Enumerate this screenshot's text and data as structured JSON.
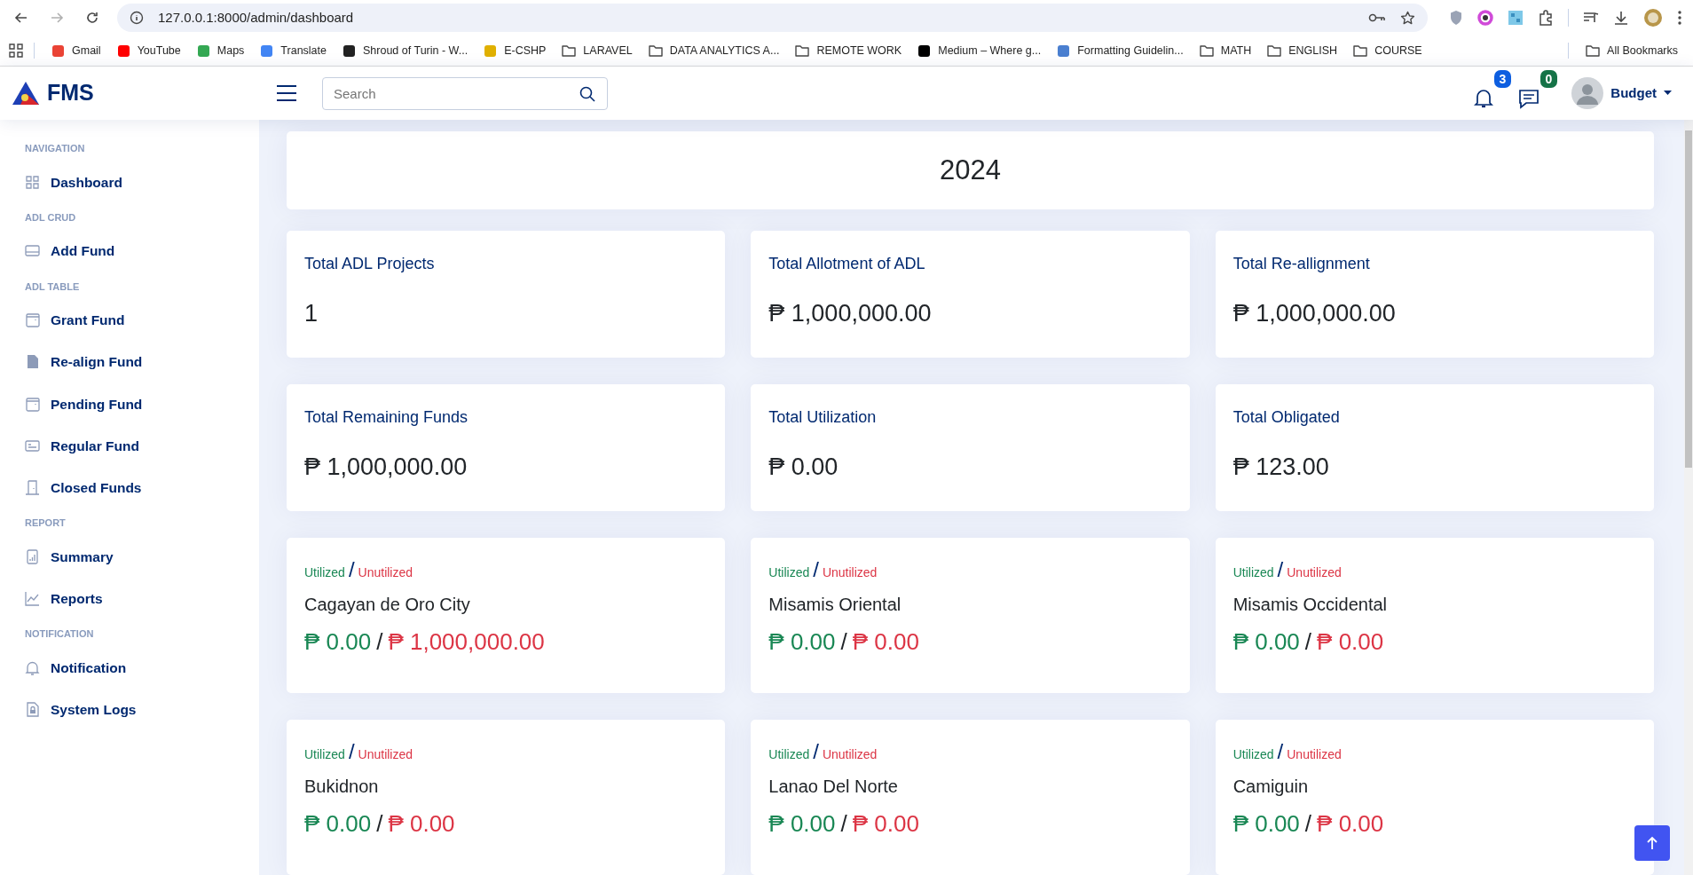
{
  "browser": {
    "back_enabled": true,
    "forward_enabled": false,
    "url": "127.0.0.1:8000/admin/dashboard",
    "bookmarks": [
      {
        "kind": "site",
        "label": "Gmail",
        "color": "#ea4335"
      },
      {
        "kind": "site",
        "label": "YouTube",
        "color": "#ff0000"
      },
      {
        "kind": "site",
        "label": "Maps",
        "color": "#34a853"
      },
      {
        "kind": "site",
        "label": "Translate",
        "color": "#4285f4"
      },
      {
        "kind": "site",
        "label": "Shroud of Turin - W...",
        "color": "#222222"
      },
      {
        "kind": "site",
        "label": "E-CSHP",
        "color": "#e0b000"
      },
      {
        "kind": "folder",
        "label": "LARAVEL"
      },
      {
        "kind": "folder",
        "label": "DATA ANALYTICS A..."
      },
      {
        "kind": "folder",
        "label": "REMOTE WORK"
      },
      {
        "kind": "site",
        "label": "Medium – Where g...",
        "color": "#000000"
      },
      {
        "kind": "site",
        "label": "Formatting Guidelin...",
        "color": "#4a7fd0"
      },
      {
        "kind": "folder",
        "label": "MATH"
      },
      {
        "kind": "folder",
        "label": "ENGLISH"
      },
      {
        "kind": "folder",
        "label": "COURSE"
      }
    ],
    "all_bookmarks": "All Bookmarks"
  },
  "header": {
    "brand": "FMS",
    "search": {
      "placeholder": "Search"
    },
    "notifications_count": "3",
    "messages_count": "0",
    "user": "Budget"
  },
  "sidebar": {
    "sections": [
      {
        "heading": "NAVIGATION",
        "items": [
          {
            "label": "Dashboard",
            "kind": "grid"
          }
        ]
      },
      {
        "heading": "ADL CRUD",
        "items": [
          {
            "label": "Add Fund",
            "kind": "card"
          }
        ]
      },
      {
        "heading": "ADL TABLE",
        "items": [
          {
            "label": "Grant Fund",
            "kind": "calendar"
          },
          {
            "label": "Re-align Fund",
            "kind": "file"
          },
          {
            "label": "Pending Fund",
            "kind": "calendar"
          },
          {
            "label": "Regular Fund",
            "kind": "list"
          },
          {
            "label": "Closed Funds",
            "kind": "door"
          }
        ]
      },
      {
        "heading": "REPORT",
        "items": [
          {
            "label": "Summary",
            "kind": "bars"
          },
          {
            "label": "Reports",
            "kind": "line"
          }
        ]
      },
      {
        "heading": "NOTIFICATION",
        "items": [
          {
            "label": "Notification",
            "kind": "bell"
          },
          {
            "label": "System Logs",
            "kind": "lock"
          }
        ]
      }
    ]
  },
  "year": "2024",
  "stats": [
    {
      "title": "Total ADL Projects",
      "value": "1"
    },
    {
      "title": "Total Allotment of ADL",
      "value": "₱ 1,000,000.00"
    },
    {
      "title": "Total Re-allignment",
      "value": "₱ 1,000,000.00"
    },
    {
      "title": "Total Remaining Funds",
      "value": "₱ 1,000,000.00"
    },
    {
      "title": "Total Utilization",
      "value": "₱ 0.00"
    },
    {
      "title": "Total Obligated",
      "value": "₱ 123.00"
    }
  ],
  "regions": [
    {
      "utilized_label": "Utilized",
      "label_separator": "/",
      "unutilized_label": "Unutilized",
      "name": "Cagayan de Oro City",
      "utilized": "₱ 0.00",
      "amount_separator": "/",
      "unutilized": "₱ 1,000,000.00"
    },
    {
      "utilized_label": "Utilized",
      "label_separator": "/",
      "unutilized_label": "Unutilized",
      "name": "Misamis Oriental",
      "utilized": "₱ 0.00",
      "amount_separator": "/",
      "unutilized": "₱ 0.00"
    },
    {
      "utilized_label": "Utilized",
      "label_separator": "/",
      "unutilized_label": "Unutilized",
      "name": "Misamis Occidental",
      "utilized": "₱ 0.00",
      "amount_separator": "/",
      "unutilized": "₱ 0.00"
    },
    {
      "utilized_label": "Utilized",
      "label_separator": "/",
      "unutilized_label": "Unutilized",
      "name": "Bukidnon",
      "utilized": "₱ 0.00",
      "amount_separator": "/",
      "unutilized": "₱ 0.00"
    },
    {
      "utilized_label": "Utilized",
      "label_separator": "/",
      "unutilized_label": "Unutilized",
      "name": "Lanao Del Norte",
      "utilized": "₱ 0.00",
      "amount_separator": "/",
      "unutilized": "₱ 0.00"
    },
    {
      "utilized_label": "Utilized",
      "label_separator": "/",
      "unutilized_label": "Unutilized",
      "name": "Camiguin",
      "utilized": "₱ 0.00",
      "amount_separator": "/",
      "unutilized": "₱ 0.00"
    }
  ]
}
